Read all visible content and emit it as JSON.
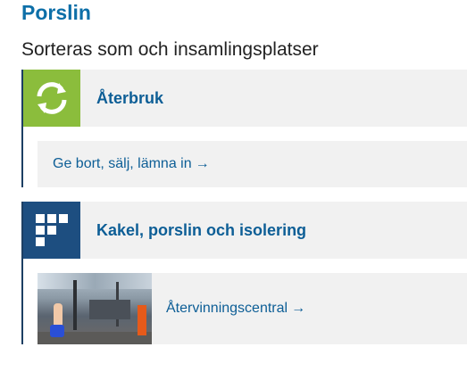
{
  "page": {
    "title": "Porslin",
    "section_heading": "Sorteras som och insamlingsplatser"
  },
  "cards": [
    {
      "header_label": "Återbruk",
      "icon": "recycle-arrows-icon",
      "icon_color": "#8bbd3c",
      "link_label": "Ge bort, sälj, lämna in",
      "link_arrow": "→"
    },
    {
      "header_label": "Kakel, porslin och isolering",
      "icon": "blocks-icon",
      "icon_color": "#1d4e80",
      "link_label": "Återvinningscentral",
      "link_arrow": "→"
    }
  ],
  "colors": {
    "link": "#0d5e96",
    "title": "#0d6fa8",
    "card_background": "#f1f1f1",
    "card_border": "#1d3f63"
  }
}
